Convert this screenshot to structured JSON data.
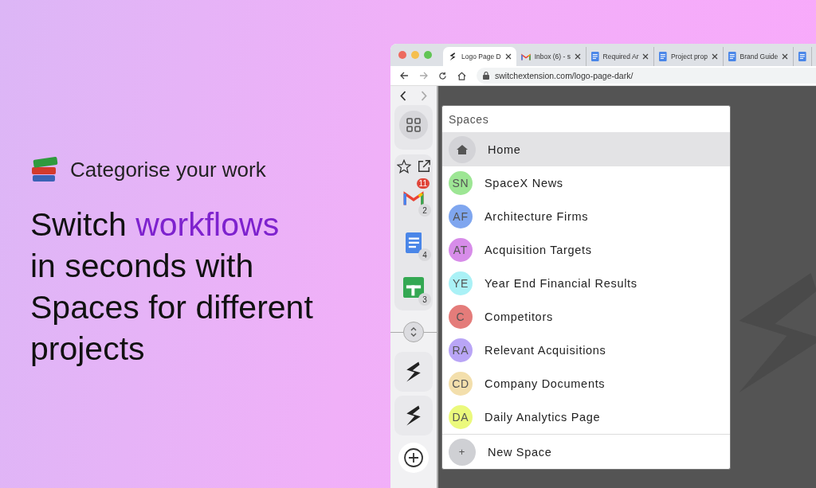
{
  "promo": {
    "tagline": "Categorise your work",
    "headline": [
      [
        {
          "text": "Switch ",
          "accent": false
        },
        {
          "text": "workflows",
          "accent": true
        }
      ],
      [
        {
          "text": "in seconds with",
          "accent": false
        }
      ],
      [
        {
          "text": "Spaces for different",
          "accent": false
        }
      ],
      [
        {
          "text": "projects",
          "accent": false
        }
      ]
    ]
  },
  "browser": {
    "tabs": [
      {
        "kind": "bolt",
        "title": "Logo Page D",
        "selected": true
      },
      {
        "kind": "gmail",
        "title": "Inbox (6) - s",
        "selected": false
      },
      {
        "kind": "docs",
        "title": "Required Ar",
        "selected": false
      },
      {
        "kind": "docs",
        "title": "Project prop",
        "selected": false
      },
      {
        "kind": "docs",
        "title": "Brand Guide",
        "selected": false
      },
      {
        "kind": "docs",
        "selected": false
      }
    ],
    "url": "switchextension.com/logo-page-dark/",
    "sidebar": {
      "apps": [
        {
          "kind": "gmail",
          "badge": "11",
          "count": "2"
        },
        {
          "kind": "docs",
          "count": "4"
        },
        {
          "kind": "sheets",
          "count": "3"
        }
      ],
      "workspaces": [
        {
          "kind": "bolt"
        },
        {
          "kind": "bolt"
        }
      ]
    },
    "spaces_menu": {
      "title": "Spaces",
      "items": [
        {
          "kind": "home",
          "label": "Home",
          "selected": true
        },
        {
          "kind": "space",
          "initials": "SN",
          "label": "SpaceX News",
          "color": "#9de694",
          "selected": false
        },
        {
          "kind": "space",
          "initials": "AF",
          "label": "Architecture Firms",
          "color": "#7fa6ef",
          "selected": false
        },
        {
          "kind": "space",
          "initials": "AT",
          "label": "Acquisition Targets",
          "color": "#d78ce9",
          "selected": false
        },
        {
          "kind": "space",
          "initials": "YE",
          "label": "Year End Financial Results",
          "color": "#aaf1f6",
          "selected": false
        },
        {
          "kind": "space",
          "initials": "C",
          "label": "Competitors",
          "color": "#e47c7a",
          "selected": false
        },
        {
          "kind": "space",
          "initials": "RA",
          "label": "Relevant Acquisitions",
          "color": "#b9a5f6",
          "selected": false
        },
        {
          "kind": "space",
          "initials": "CD",
          "label": "Company Documents",
          "color": "#f3dfac",
          "selected": false
        },
        {
          "kind": "space",
          "initials": "DA",
          "label": "Daily Analytics Page",
          "color": "#ebf97c",
          "selected": false
        },
        {
          "kind": "new",
          "initials": "+",
          "label": "New Space",
          "selected": false
        }
      ]
    }
  }
}
